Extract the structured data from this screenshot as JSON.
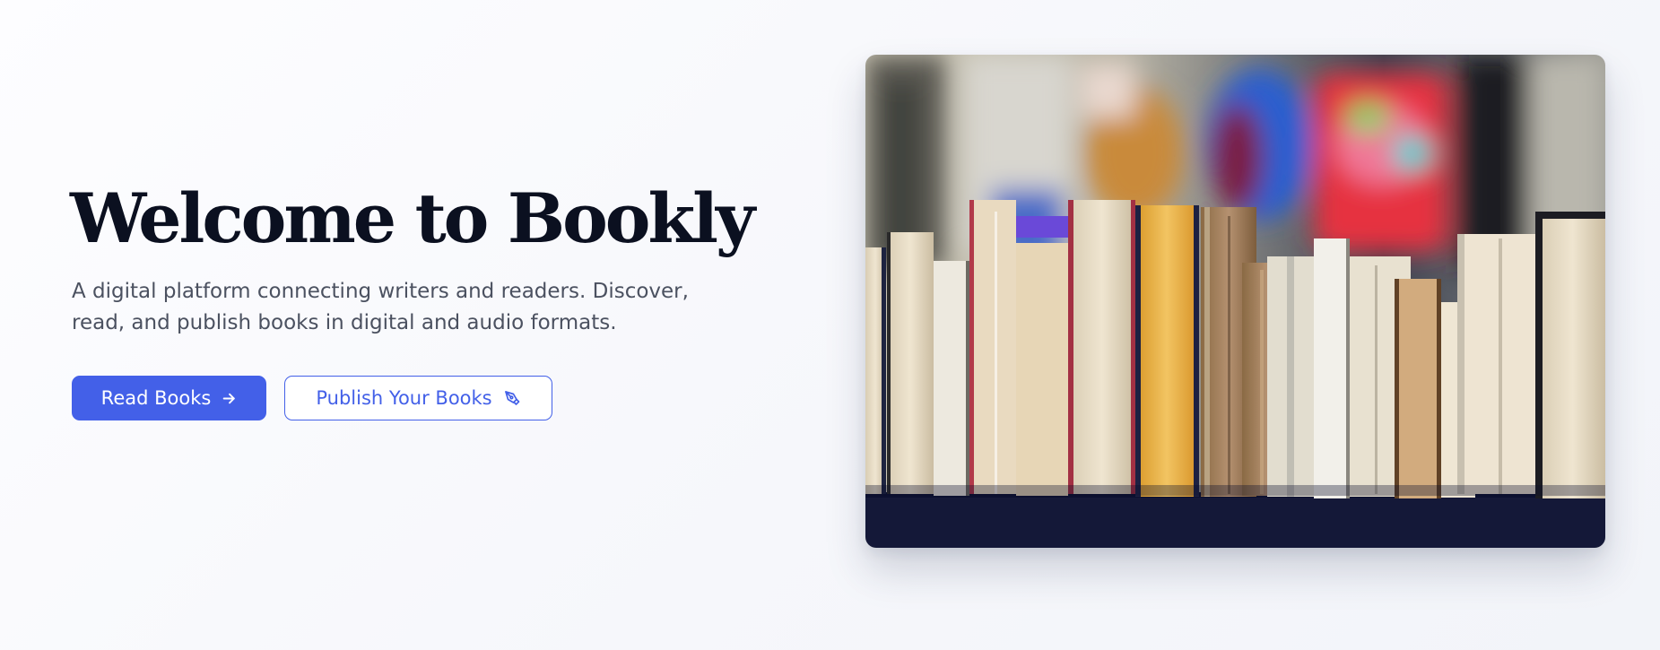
{
  "hero": {
    "title": "Welcome to Bookly",
    "subtitle": "A digital platform connecting writers and readers. Discover, read, and publish books in digital and audio formats.",
    "primary_button": {
      "label": "Read Books",
      "icon": "arrow-right-icon"
    },
    "secondary_button": {
      "label": "Publish Your Books",
      "icon": "pen-nib-icon"
    },
    "image": {
      "alt": "Row of old books on a shelf",
      "subject": "books-on-shelf"
    }
  },
  "colors": {
    "accent": "#4360e8",
    "title": "#0b1020",
    "body_text": "#4b5160",
    "background": "#f6f7fb"
  }
}
